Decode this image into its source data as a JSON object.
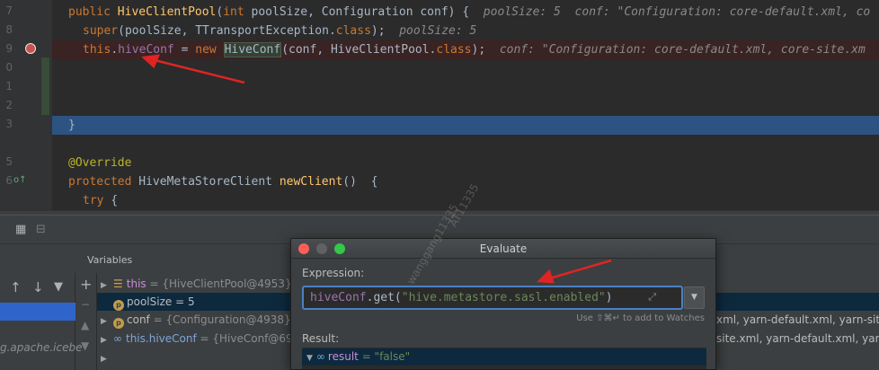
{
  "editor": {
    "line_numbers": [
      "7",
      "8",
      "9",
      "0",
      "1",
      "2",
      "3",
      "",
      "5",
      "6",
      ""
    ],
    "lines": {
      "l1": {
        "kw1": "public ",
        "cls": "HiveClientPool",
        "p1": "(",
        "kw2": "int",
        "p2": " poolSize, Configuration conf) {",
        "hint": "  poolSize: 5  conf: \"Configuration: core-default.xml, co"
      },
      "l2": {
        "fn": "super",
        "p1": "(poolSize, TTransportException.",
        "kw": "class",
        "p2": ");",
        "hint": "  poolSize: 5"
      },
      "l3": {
        "kw1": "this",
        "p1": ".",
        "fld": "hiveConf",
        "p2": " = ",
        "kw2": "new ",
        "cls": "HiveConf",
        "p3": "(conf, HiveClientPool.",
        "kw3": "class",
        "p4": ");",
        "hint": "  conf: \"Configuration: core-default.xml, core-site.xm"
      },
      "l7": {
        "p1": "}"
      },
      "l9": {
        "ann": "@Override"
      },
      "l10": {
        "kw": "protected ",
        "p1": "HiveMetaStoreClient ",
        "fn": "newClient",
        "p2": "()  {"
      },
      "l11": {
        "kw": "try",
        "p1": " {"
      }
    }
  },
  "variables": {
    "title": "Variables",
    "rows": [
      {
        "name": "this",
        "value": " = {HiveClientPool@4953}"
      },
      {
        "name": "poolSize",
        "value": " = 5"
      },
      {
        "name": "conf",
        "value": " = {Configuration@4938}"
      },
      {
        "name": "this.hiveConf",
        "value": " = {HiveConf@69"
      }
    ],
    "overflow": [
      "xml, yarn-default.xml, yarn-site.",
      "site.xml, yarn-default.xml, yarn-"
    ]
  },
  "frames": {
    "selected_text": "g.apache.icebe"
  },
  "evaluate": {
    "title": "Evaluate",
    "expression_label": "Expression:",
    "expression": {
      "obj": "hiveConf",
      "call": ".get(",
      "str": "\"hive.metastore.sasl.enabled\"",
      "close": ")"
    },
    "watch_hint": "Use ⇧⌘↵ to add to Watches",
    "result_label": "Result:",
    "result_name": "result",
    "result_value": " = \"false\""
  },
  "watermark": {
    "line1": "wanggang11335",
    "line2": "AT11335"
  },
  "colors": {
    "arrow": "#e02424",
    "breakpoint": "#c75450",
    "execution_line": "#2d5382"
  }
}
